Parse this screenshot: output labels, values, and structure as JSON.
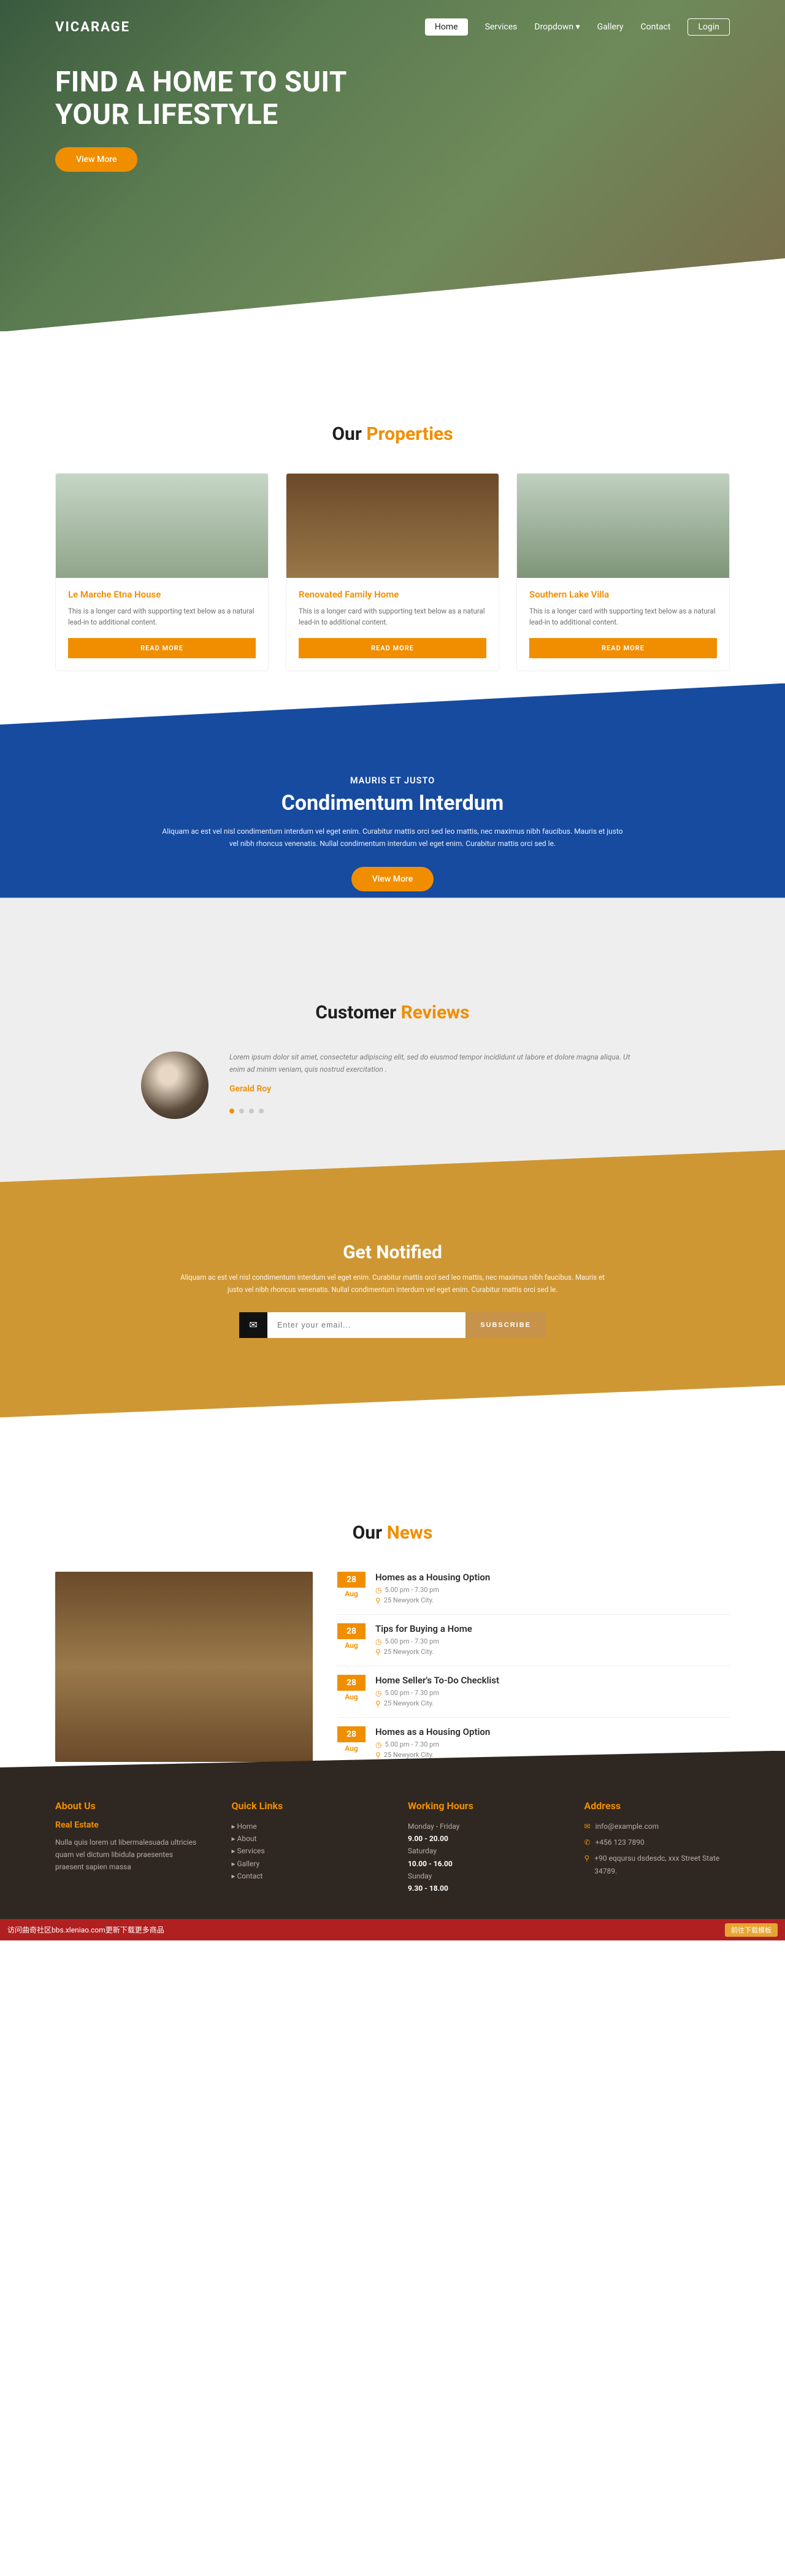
{
  "nav": {
    "logo": "VICARAGE",
    "home": "Home",
    "services": "Services",
    "dropdown": "Dropdown",
    "gallery": "Gallery",
    "contact": "Contact",
    "login": "Login"
  },
  "hero": {
    "title": "FIND A HOME TO SUIT YOUR LIFESTYLE",
    "cta": "View More"
  },
  "properties": {
    "title_a": "Our ",
    "title_b": "Properties",
    "items": [
      {
        "title": "Le Marche Etna House",
        "desc": "This is a longer card with supporting text below as a natural lead-in to additional content.",
        "cta": "READ MORE"
      },
      {
        "title": "Renovated Family Home",
        "desc": "This is a longer card with supporting text below as a natural lead-in to additional content.",
        "cta": "READ MORE"
      },
      {
        "title": "Southern Lake Villa",
        "desc": "This is a longer card with supporting text below as a natural lead-in to additional content.",
        "cta": "READ MORE"
      }
    ]
  },
  "band": {
    "kicker": "MAURIS ET JUSTO",
    "title": "Condimentum Interdum",
    "desc": "Aliquam ac est vel nisl condimentum interdum vel eget enim. Curabitur mattis orci sed leo mattis, nec maximus nibh faucibus. Mauris et justo vel nibh rhoncus venenatis. Nullal condimentum interdum vel eget enim. Curabitur mattis orci sed le.",
    "cta": "View More"
  },
  "reviews": {
    "title_a": "Customer ",
    "title_b": "Reviews",
    "text": "Lorem ipsum dolor sit amet, consectetur adipiscing elit, sed do eiusmod tempor incididunt ut labore et dolore magna aliqua. Ut enim ad minim veniam, quis nostrud exercitation .",
    "name": "Gerald Roy"
  },
  "notify": {
    "title_a": "Get ",
    "title_b": "Notified",
    "desc": "Aliquam ac est vel nisl condimentum interdum vel eget enim. Curabitur mattis orci sed leo mattis, nec maximus nibh faucibus. Mauris et justo vel nibh rhoncus venenatis. Nullal condimentum interdum vel eget enim. Curabitur mattis orci sed le.",
    "placeholder": "Enter your email...",
    "cta": "SUBSCRIBE"
  },
  "news": {
    "title_a": "Our ",
    "title_b": "News",
    "items": [
      {
        "day": "28",
        "month": "Aug",
        "title": "Homes as a Housing Option",
        "time": "5.00 pm - 7.30 pm",
        "place": "25 Newyork City."
      },
      {
        "day": "28",
        "month": "Aug",
        "title": "Tips for Buying a Home",
        "time": "5.00 pm - 7.30 pm",
        "place": "25 Newyork City."
      },
      {
        "day": "28",
        "month": "Aug",
        "title": "Home Seller's To-Do Checklist",
        "time": "5.00 pm - 7.30 pm",
        "place": "25 Newyork City."
      },
      {
        "day": "28",
        "month": "Aug",
        "title": "Homes as a Housing Option",
        "time": "5.00 pm - 7.30 pm",
        "place": "25 Newyork City."
      }
    ]
  },
  "footer": {
    "about_h": "About Us",
    "about_sub": "Real Estate",
    "about_p": "Nulla quis lorem ut libermalesuada ultricies quam vel dictum libidula praesentes praesent sapien massa",
    "quick_h": "Quick Links",
    "quick": [
      "Home",
      "About",
      "Services",
      "Gallery",
      "Contact"
    ],
    "hours_h": "Working Hours",
    "hours": [
      {
        "label": "Monday - Friday",
        "val": "9.00 - 20.00"
      },
      {
        "label": "Saturday",
        "val": "10.00 - 16.00"
      },
      {
        "label": "Sunday",
        "val": "9.30 - 18.00"
      }
    ],
    "addr_h": "Address",
    "email": "info@example.com",
    "phone": "+456 123 7890",
    "addr": "+90 eqqursu dsdesdc, xxx Street State 34789."
  },
  "banner": {
    "left": "访问曲奇社区bbs.xleniao.com更新下载更多商品",
    "right": "前往下载模板"
  }
}
